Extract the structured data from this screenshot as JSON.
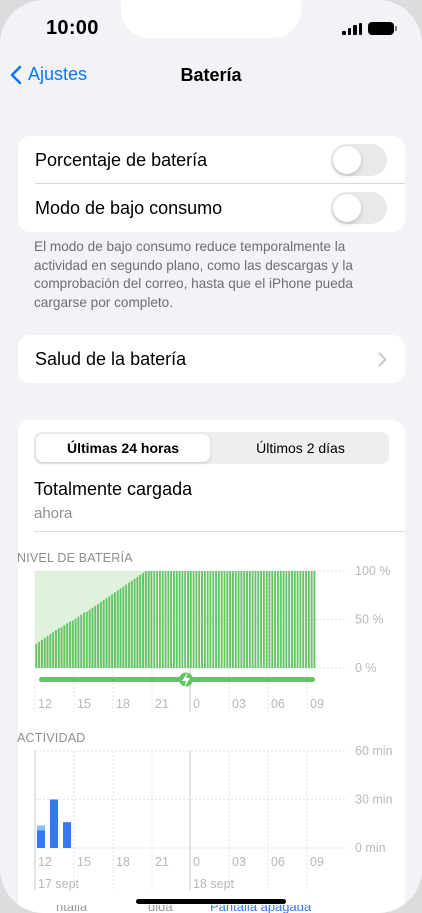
{
  "status_bar": {
    "time": "10:00"
  },
  "nav": {
    "back_label": "Ajustes",
    "title": "Batería"
  },
  "settings": {
    "battery_percentage_label": "Porcentaje de batería",
    "battery_percentage_on": false,
    "low_power_label": "Modo de bajo consumo",
    "low_power_on": false,
    "low_power_footnote": "El modo de bajo consumo reduce temporalmente la actividad en segundo plano, como las descargas y la comprobación del correo, hasta que el iPhone pueda cargarse por completo.",
    "battery_health_label": "Salud de la batería"
  },
  "usage": {
    "tabs": [
      {
        "label": "Últimas 24 horas",
        "selected": true
      },
      {
        "label": "Últimos 2 días",
        "selected": false
      }
    ],
    "charge_status": "Totalmente cargada",
    "charge_time": "ahora"
  },
  "chart_data": [
    {
      "type": "bar",
      "title": "NIVEL DE BATERÍA",
      "x_ticks": [
        "12",
        "15",
        "18",
        "21",
        "0",
        "03",
        "06",
        "09"
      ],
      "y_ticks": [
        "100 %",
        "50 %",
        "0 %"
      ],
      "ylim": [
        0,
        100
      ],
      "levels": [
        25,
        27,
        29,
        31,
        33,
        35,
        37,
        39,
        41,
        42,
        44,
        46,
        48,
        49,
        51,
        53,
        55,
        57,
        58,
        60,
        62,
        64,
        66,
        68,
        70,
        72,
        74,
        76,
        78,
        80,
        82,
        84,
        86,
        88,
        90,
        92,
        94,
        96,
        98,
        100
      ],
      "full_count": 60,
      "charging_strip": true,
      "colors": {
        "bar": "#65c466",
        "charge_bg": "#dff2de",
        "strip": "#65c466",
        "bolt": "#ffffff"
      }
    },
    {
      "type": "bar",
      "title": "ACTIVIDAD",
      "x_ticks": [
        "12",
        "15",
        "18",
        "21",
        "0",
        "03",
        "06",
        "09"
      ],
      "y_ticks": [
        "60 min",
        "30 min",
        "0 min"
      ],
      "ylim": [
        0,
        60
      ],
      "screen_on": [
        11,
        30,
        16
      ],
      "screen_off": [
        3,
        0,
        0
      ],
      "date_labels": [
        "17 sept",
        "18 sept"
      ],
      "colors": {
        "screen_on": "#3478f6",
        "screen_off": "#82c3f8"
      }
    }
  ],
  "bottom_peek": {
    "left": "ntalla",
    "middle": "dida",
    "right": "Pantalla apagada"
  }
}
